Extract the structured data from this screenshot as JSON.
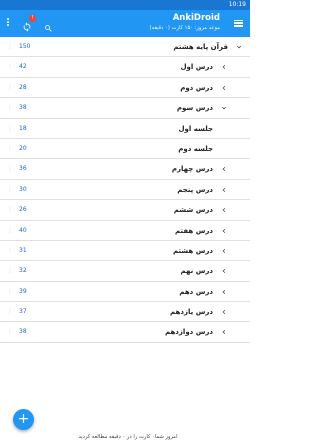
{
  "status_bar": {
    "time": "10:19"
  },
  "toolbar": {
    "title": "AnkiDroid",
    "subtitle": "موعد مروز: ۱۵۰ کارت (۰ دقیقه)",
    "sync_badge": "!",
    "colors": {
      "toolbar": "#2196f3",
      "status_bar": "#1976d2"
    }
  },
  "decks": [
    {
      "name": "قرآن پایه هشتم",
      "count": "150",
      "expanded": true,
      "level": 0
    },
    {
      "name": "درس اول",
      "count": "42",
      "expanded": false,
      "level": 1
    },
    {
      "name": "درس دوم",
      "count": "28",
      "expanded": false,
      "level": 1
    },
    {
      "name": "درس سوم",
      "count": "38",
      "expanded": true,
      "level": 1
    },
    {
      "name": "جلسه اول",
      "count": "18",
      "expanded": null,
      "level": 2
    },
    {
      "name": "جلسه دوم",
      "count": "20",
      "expanded": null,
      "level": 2
    },
    {
      "name": "درس چهارم",
      "count": "36",
      "expanded": false,
      "level": 1
    },
    {
      "name": "درس پنجم",
      "count": "30",
      "expanded": false,
      "level": 1
    },
    {
      "name": "درس ششم",
      "count": "26",
      "expanded": false,
      "level": 1
    },
    {
      "name": "درس هفتم",
      "count": "40",
      "expanded": false,
      "level": 1
    },
    {
      "name": "درس هشتم",
      "count": "31",
      "expanded": false,
      "level": 1
    },
    {
      "name": "درس نهم",
      "count": "32",
      "expanded": false,
      "level": 1
    },
    {
      "name": "درس دهم",
      "count": "39",
      "expanded": false,
      "level": 1
    },
    {
      "name": "درس یازدهم",
      "count": "37",
      "expanded": false,
      "level": 1
    },
    {
      "name": "درس دوازدهم",
      "count": "38",
      "expanded": false,
      "level": 1
    }
  ],
  "fab": {
    "label": "+"
  },
  "footer": {
    "text": "امروز شما۰ کارت را در ۰ دقیقه مطالعه کردید"
  }
}
